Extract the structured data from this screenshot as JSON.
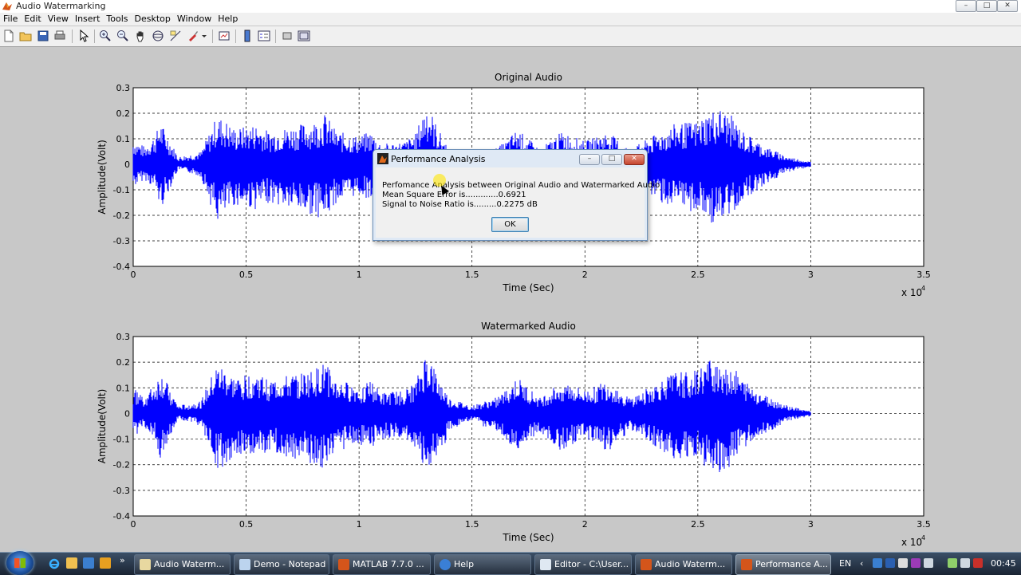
{
  "window": {
    "title": "Audio Watermarking"
  },
  "menu": [
    "File",
    "Edit",
    "View",
    "Insert",
    "Tools",
    "Desktop",
    "Window",
    "Help"
  ],
  "toolbar_icons": [
    "new-file-icon",
    "open-folder-icon",
    "save-icon",
    "print-icon",
    "pointer-icon",
    "zoom-in-icon",
    "zoom-out-icon",
    "pan-hand-icon",
    "rotate-3d-icon",
    "data-cursor-icon",
    "brush-icon",
    "link-plot-icon",
    "colorbar-icon",
    "legend-icon",
    "hide-plot-tools-icon",
    "show-plot-tools-icon"
  ],
  "chart_data": [
    {
      "type": "line",
      "title": "Original Audio",
      "xlabel": "Time (Sec)",
      "ylabel": "Amplitude(Volt)",
      "xlim": [
        0,
        3.5
      ],
      "ylim": [
        -0.4,
        0.3
      ],
      "x_exponent_label": "x 10",
      "x_exponent": "4",
      "xticks": [
        "0",
        "0.5",
        "1",
        "1.5",
        "2",
        "2.5",
        "3",
        "3.5"
      ],
      "yticks": [
        "0.3",
        "0.2",
        "0.1",
        "0",
        "-0.1",
        "-0.2",
        "-0.3",
        "-0.4"
      ],
      "grid": true,
      "color": "#0000ff",
      "x": [
        0,
        0.05,
        0.1,
        0.12,
        0.2,
        0.3,
        0.37,
        0.4,
        0.45,
        0.55,
        0.6,
        0.7,
        0.8,
        0.85,
        0.9,
        1.0,
        1.05,
        1.1,
        1.2,
        1.25,
        1.3,
        1.35,
        1.4,
        1.5,
        1.6,
        1.65,
        1.7,
        1.8,
        1.9,
        1.95,
        2.0,
        2.1,
        2.2,
        2.3,
        2.4,
        2.5,
        2.55,
        2.6,
        2.65,
        2.7,
        2.8,
        2.9,
        3.0
      ],
      "upper": [
        0.1,
        0.07,
        0.12,
        0.17,
        0.03,
        0.05,
        0.19,
        0.18,
        0.14,
        0.16,
        0.13,
        0.15,
        0.17,
        0.2,
        0.13,
        0.11,
        0.13,
        0.08,
        0.09,
        0.12,
        0.25,
        0.14,
        0.06,
        0.03,
        0.06,
        0.09,
        0.14,
        0.06,
        0.13,
        0.11,
        0.09,
        0.13,
        0.06,
        0.11,
        0.16,
        0.17,
        0.21,
        0.22,
        0.19,
        0.13,
        0.07,
        0.03,
        0.01
      ],
      "lower": [
        -0.09,
        -0.06,
        -0.1,
        -0.18,
        -0.02,
        -0.05,
        -0.23,
        -0.21,
        -0.16,
        -0.18,
        -0.15,
        -0.18,
        -0.2,
        -0.22,
        -0.15,
        -0.12,
        -0.14,
        -0.1,
        -0.11,
        -0.14,
        -0.23,
        -0.2,
        -0.07,
        -0.03,
        -0.07,
        -0.1,
        -0.17,
        -0.07,
        -0.15,
        -0.12,
        -0.1,
        -0.15,
        -0.07,
        -0.13,
        -0.18,
        -0.19,
        -0.23,
        -0.24,
        -0.2,
        -0.14,
        -0.08,
        -0.03,
        -0.01
      ]
    },
    {
      "type": "line",
      "title": "Watermarked Audio",
      "xlabel": "Time (Sec)",
      "ylabel": "Amplitude(Volt)",
      "xlim": [
        0,
        3.5
      ],
      "ylim": [
        -0.4,
        0.3
      ],
      "x_exponent_label": "x 10",
      "x_exponent": "4",
      "xticks": [
        "0",
        "0.5",
        "1",
        "1.5",
        "2",
        "2.5",
        "3",
        "3.5"
      ],
      "yticks": [
        "0.3",
        "0.2",
        "0.1",
        "0",
        "-0.1",
        "-0.2",
        "-0.3",
        "-0.4"
      ],
      "grid": true,
      "color": "#0000ff",
      "x": [
        0,
        0.05,
        0.1,
        0.12,
        0.2,
        0.3,
        0.37,
        0.4,
        0.45,
        0.55,
        0.6,
        0.7,
        0.8,
        0.85,
        0.9,
        1.0,
        1.05,
        1.1,
        1.2,
        1.25,
        1.3,
        1.35,
        1.4,
        1.5,
        1.6,
        1.65,
        1.7,
        1.8,
        1.9,
        1.95,
        2.0,
        2.1,
        2.2,
        2.3,
        2.4,
        2.5,
        2.55,
        2.6,
        2.65,
        2.7,
        2.8,
        2.9,
        3.0
      ],
      "upper": [
        0.1,
        0.07,
        0.12,
        0.17,
        0.03,
        0.05,
        0.19,
        0.18,
        0.14,
        0.16,
        0.13,
        0.15,
        0.17,
        0.2,
        0.13,
        0.11,
        0.13,
        0.08,
        0.09,
        0.12,
        0.25,
        0.14,
        0.06,
        0.03,
        0.06,
        0.09,
        0.14,
        0.06,
        0.13,
        0.11,
        0.09,
        0.13,
        0.06,
        0.11,
        0.16,
        0.17,
        0.21,
        0.22,
        0.19,
        0.13,
        0.07,
        0.03,
        0.01
      ],
      "lower": [
        -0.09,
        -0.06,
        -0.1,
        -0.18,
        -0.02,
        -0.05,
        -0.23,
        -0.21,
        -0.16,
        -0.18,
        -0.15,
        -0.18,
        -0.2,
        -0.22,
        -0.15,
        -0.12,
        -0.14,
        -0.1,
        -0.11,
        -0.14,
        -0.23,
        -0.2,
        -0.07,
        -0.03,
        -0.07,
        -0.1,
        -0.17,
        -0.07,
        -0.15,
        -0.12,
        -0.1,
        -0.15,
        -0.07,
        -0.13,
        -0.18,
        -0.19,
        -0.23,
        -0.24,
        -0.2,
        -0.14,
        -0.08,
        -0.03,
        -0.01
      ]
    }
  ],
  "dialog": {
    "title": "Performance Analysis",
    "line1": "Perfomance Analysis between Original Audio and Watermarked Audio",
    "line2": "Mean Square Error is.............0.6921",
    "line3": "Signal to Noise Ratio is.........0.2275 dB",
    "ok_label": "OK"
  },
  "taskbar": {
    "tasks": [
      {
        "label": "Audio Waterm...",
        "icon": "matlab-figure-icon"
      },
      {
        "label": "Demo - Notepad",
        "icon": "notepad-icon"
      },
      {
        "label": "MATLAB 7.7.0 ...",
        "icon": "matlab-icon"
      },
      {
        "label": "Help",
        "icon": "help-icon"
      },
      {
        "label": "Editor - C:\\User...",
        "icon": "editor-icon"
      },
      {
        "label": "Audio Waterm...",
        "icon": "matlab-figure-icon"
      },
      {
        "label": "Performance A...",
        "icon": "matlab-figure-icon"
      }
    ],
    "language": "EN",
    "clock": "00:45"
  },
  "colors": {
    "signal": "#0000ff",
    "figure_bg": "#c8c8c8",
    "axes_bg": "#ffffff"
  }
}
